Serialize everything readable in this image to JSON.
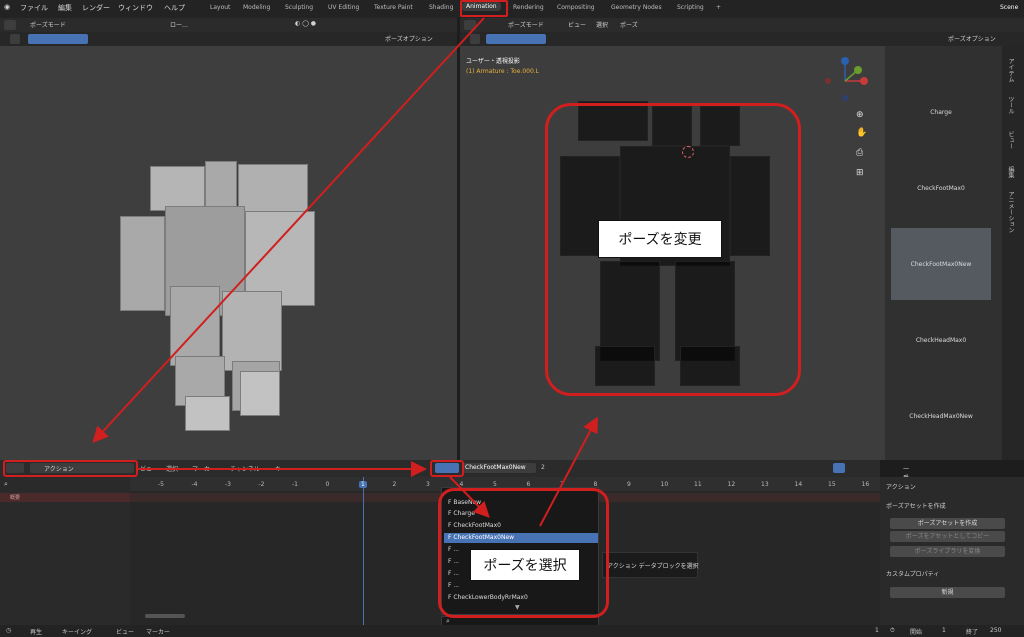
{
  "topbar": {
    "menus": [
      "ファイル",
      "編集",
      "レンダー",
      "ウィンドウ",
      "ヘルプ"
    ],
    "workspaces": [
      "Layout",
      "Modeling",
      "Sculpting",
      "UV Editing",
      "Texture Paint",
      "Shading",
      "Animation",
      "Rendering",
      "Compositing",
      "Geometry Nodes",
      "Scripting"
    ],
    "active_workspace": "Animation",
    "plus": "+",
    "scene": "Scene"
  },
  "left_viewport": {
    "mode": "ポーズモード",
    "view_menu": "ロー…",
    "options": "ポーズオプション"
  },
  "right_viewport": {
    "mode": "ポーズモード",
    "menus": [
      "ビュー",
      "選択",
      "ポーズ"
    ],
    "options": "ポーズオプション",
    "overlay_title": "ユーザー・透視投影",
    "overlay_sub": "(1) Armature : Toe.000.L"
  },
  "asset_panel": {
    "items": [
      "Charge",
      "CheckFootMax0",
      "CheckFootMax0New",
      "CheckHeadMax0",
      "CheckHeadMax0New"
    ],
    "selected": "CheckFootMax0New"
  },
  "vertical_tabs": [
    "アイテム",
    "ツール",
    "ビュー",
    "編集",
    "アニメーション"
  ],
  "timeline": {
    "mode": "アクション",
    "menus": [
      "ビュー",
      "選択",
      "マーカー",
      "チャンネル",
      "キー"
    ],
    "action_name": "CheckFootMax0New",
    "user_count": "2",
    "snap": "一番近いフレーム",
    "ruler": [
      "-5",
      "-4",
      "-3",
      "-2",
      "-1",
      "0",
      "1",
      "2",
      "3",
      "4",
      "5",
      "6",
      "7",
      "8",
      "9",
      "10",
      "11",
      "12",
      "13",
      "14",
      "15",
      "16"
    ],
    "current_frame": "1",
    "summary_label": "概要",
    "tooltip": "アクション データブロックを選択"
  },
  "dropdown": {
    "items": [
      "F BaseNew",
      "F Charge",
      "F CheckFootMax0",
      "F CheckFootMax0New",
      "F ...",
      "F ...",
      "F ...",
      "F ...",
      "F CheckLowerBodyRrMax0"
    ],
    "selected_index": 3,
    "search_placeholder": ""
  },
  "side_panel": {
    "action_section": "アクション",
    "pose_asset_section": "ポーズアセットを作成",
    "create_pose_asset": "ポーズアセットを作成",
    "copy_as_asset": "ポーズをアセットとしてコピー",
    "paste_to_library": "ポーズライブラリを変換",
    "custom_props_section": "カスタムプロパティ",
    "new_button": "新規",
    "plus": "+"
  },
  "annotations": {
    "change_pose": "ポーズを変更",
    "select_pose": "ポーズを選択"
  },
  "statusbar": {
    "playback": "再生",
    "keying": "キーイング",
    "view": "ビュー",
    "marker": "マーカー",
    "frame": "1",
    "start_label": "開始",
    "start": "1",
    "end_label": "終了",
    "end": "250"
  },
  "colors": {
    "accent": "#4772b3",
    "annotation_red": "#d11e1e"
  }
}
